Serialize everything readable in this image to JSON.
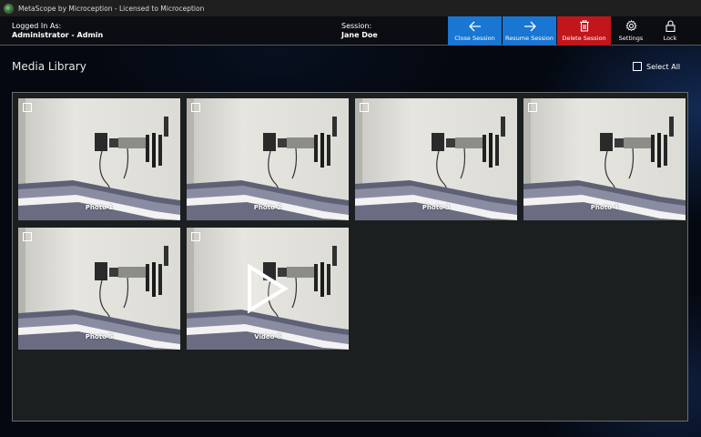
{
  "window": {
    "title": "MetaScope by Microception - Licensed to Microception"
  },
  "header": {
    "login_label": "Logged In As:",
    "login_value": "Administrator - Admin",
    "session_label": "Session:",
    "session_value": "Jane Doe",
    "actions": {
      "close_session": "Close Session",
      "resume_session": "Resume Session",
      "delete_session": "Delete Session",
      "settings": "Settings",
      "lock": "Lock"
    }
  },
  "library": {
    "title": "Media Library",
    "select_all": "Select All",
    "items": [
      {
        "caption": "Photo 1",
        "type": "photo"
      },
      {
        "caption": "Photo 2",
        "type": "photo"
      },
      {
        "caption": "Photo 3",
        "type": "photo"
      },
      {
        "caption": "Photo 4",
        "type": "photo"
      },
      {
        "caption": "Photo 5",
        "type": "photo"
      },
      {
        "caption": "Video 6",
        "type": "video"
      }
    ]
  },
  "colors": {
    "accent_blue": "#1976d2",
    "danger_red": "#c0161c",
    "panel": "#1b1f20"
  }
}
